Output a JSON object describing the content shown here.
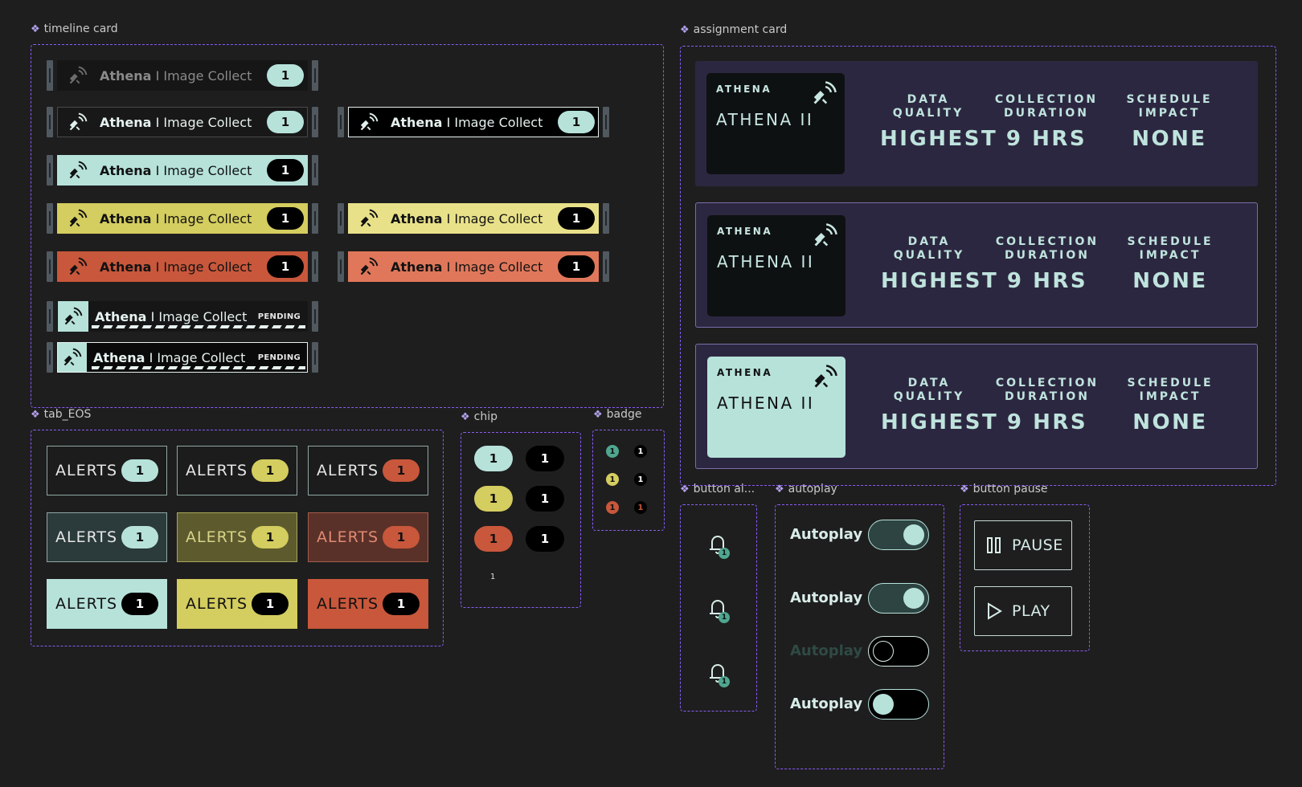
{
  "labels": {
    "timeline": "timeline card",
    "assignment": "assignment card",
    "tab": "tab_EOS",
    "chip": "chip",
    "badge": "badge",
    "button_alert": "button al...",
    "autoplay": "autoplay",
    "button_pause": "button pause"
  },
  "timeline": {
    "name": "Athena",
    "separator": "I",
    "task": "Image Collect",
    "count": "1",
    "pending": "PENDING"
  },
  "assignment": {
    "cards": [
      {
        "sub": "ATHENA",
        "name": "ATHENA II",
        "stats": [
          {
            "label": "DATA\nQUALITY",
            "value": "HIGHEST"
          },
          {
            "label": "COLLECTION\nDURATION",
            "value": "9 HRS"
          },
          {
            "label": "SCHEDULE\nIMPACT",
            "value": "NONE"
          }
        ]
      },
      {
        "sub": "ATHENA",
        "name": "ATHENA II",
        "stats": [
          {
            "label": "DATA\nQUALITY",
            "value": "HIGHEST"
          },
          {
            "label": "COLLECTION\nDURATION",
            "value": "9 HRS"
          },
          {
            "label": "SCHEDULE\nIMPACT",
            "value": "NONE"
          }
        ]
      },
      {
        "sub": "ATHENA",
        "name": "ATHENA II",
        "stats": [
          {
            "label": "DATA\nQUALITY",
            "value": "HIGHEST"
          },
          {
            "label": "COLLECTION\nDURATION",
            "value": "9 HRS"
          },
          {
            "label": "SCHEDULE\nIMPACT",
            "value": "NONE"
          }
        ]
      }
    ]
  },
  "tabs": {
    "label": "ALERTS",
    "count": "1"
  },
  "chips": {
    "count": "1",
    "small": "1"
  },
  "badges": {
    "count": "1"
  },
  "bells": {
    "count": "1"
  },
  "autoplay": {
    "label": "Autoplay"
  },
  "buttons": {
    "pause": "PAUSE",
    "play": "PLAY"
  },
  "colors": {
    "background": "#1e1e1e",
    "frame": "#8a5cf5",
    "mint": "#b6e2da",
    "yellow": "#d4cd5f",
    "orange": "#c8573b",
    "card": "#2c2740"
  }
}
